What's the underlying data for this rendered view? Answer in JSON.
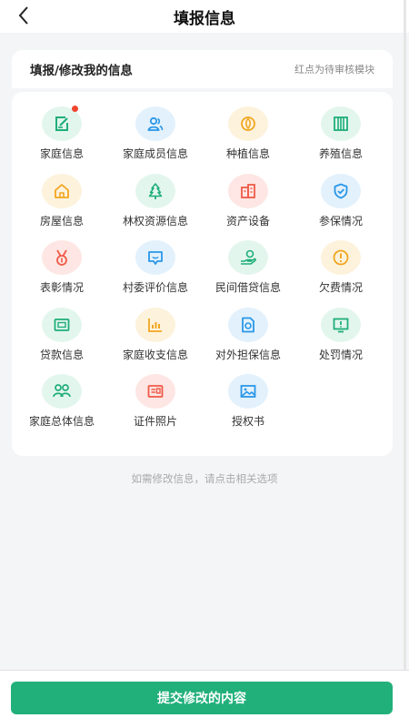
{
  "nav": {
    "title": "填报信息",
    "back_icon": "chevron-left-icon"
  },
  "header": {
    "title": "填报/修改我的信息",
    "note": "红点为待审核模块"
  },
  "grid": {
    "items": [
      {
        "label": "家庭信息",
        "icon": "edit-document-icon",
        "color": "#1fae78",
        "bg": "#e3f6ee",
        "badge": true
      },
      {
        "label": "家庭成员信息",
        "icon": "people-icon",
        "color": "#2a97e8",
        "bg": "#e2f1fc",
        "badge": false
      },
      {
        "label": "种植信息",
        "icon": "leaf-icon",
        "color": "#f2a620",
        "bg": "#fdf2dc",
        "badge": false
      },
      {
        "label": "养殖信息",
        "icon": "fence-icon",
        "color": "#1fae78",
        "bg": "#e3f6ee",
        "badge": false
      },
      {
        "label": "房屋信息",
        "icon": "house-icon",
        "color": "#f2a620",
        "bg": "#fdf2dc",
        "badge": false
      },
      {
        "label": "林权资源信息",
        "icon": "tree-icon",
        "color": "#1fae78",
        "bg": "#e3f6ee",
        "badge": false
      },
      {
        "label": "资产设备",
        "icon": "building-icon",
        "color": "#f05a48",
        "bg": "#fde6e3",
        "badge": false
      },
      {
        "label": "参保情况",
        "icon": "shield-check-icon",
        "color": "#2a97e8",
        "bg": "#e2f1fc",
        "badge": false
      },
      {
        "label": "表彰情况",
        "icon": "medal-icon",
        "color": "#f05a48",
        "bg": "#fde6e3",
        "badge": false
      },
      {
        "label": "村委评价信息",
        "icon": "comment-smile-icon",
        "color": "#2a97e8",
        "bg": "#e2f1fc",
        "badge": false
      },
      {
        "label": "民间借贷信息",
        "icon": "hand-coin-icon",
        "color": "#1fae78",
        "bg": "#e3f6ee",
        "badge": false
      },
      {
        "label": "欠费情况",
        "icon": "alert-circle-icon",
        "color": "#f2a620",
        "bg": "#fdf2dc",
        "badge": false
      },
      {
        "label": "贷款信息",
        "icon": "bank-card-icon",
        "color": "#1fae78",
        "bg": "#e3f6ee",
        "badge": false
      },
      {
        "label": "家庭收支信息",
        "icon": "bar-chart-icon",
        "color": "#f2a620",
        "bg": "#fdf2dc",
        "badge": false
      },
      {
        "label": "对外担保信息",
        "icon": "document-shield-icon",
        "color": "#2a97e8",
        "bg": "#e2f1fc",
        "badge": false
      },
      {
        "label": "处罚情况",
        "icon": "warning-board-icon",
        "color": "#1fae78",
        "bg": "#e3f6ee",
        "badge": false
      },
      {
        "label": "家庭总体信息",
        "icon": "group-icon",
        "color": "#1fae78",
        "bg": "#e3f6ee",
        "badge": false
      },
      {
        "label": "证件照片",
        "icon": "id-card-icon",
        "color": "#f05a48",
        "bg": "#fde6e3",
        "badge": false
      },
      {
        "label": "授权书",
        "icon": "image-icon",
        "color": "#2a97e8",
        "bg": "#e2f1fc",
        "badge": false
      }
    ]
  },
  "hint": "如需修改信息，请点击相关选项",
  "submit": {
    "label": "提交修改的内容",
    "color": "#21b07a"
  }
}
